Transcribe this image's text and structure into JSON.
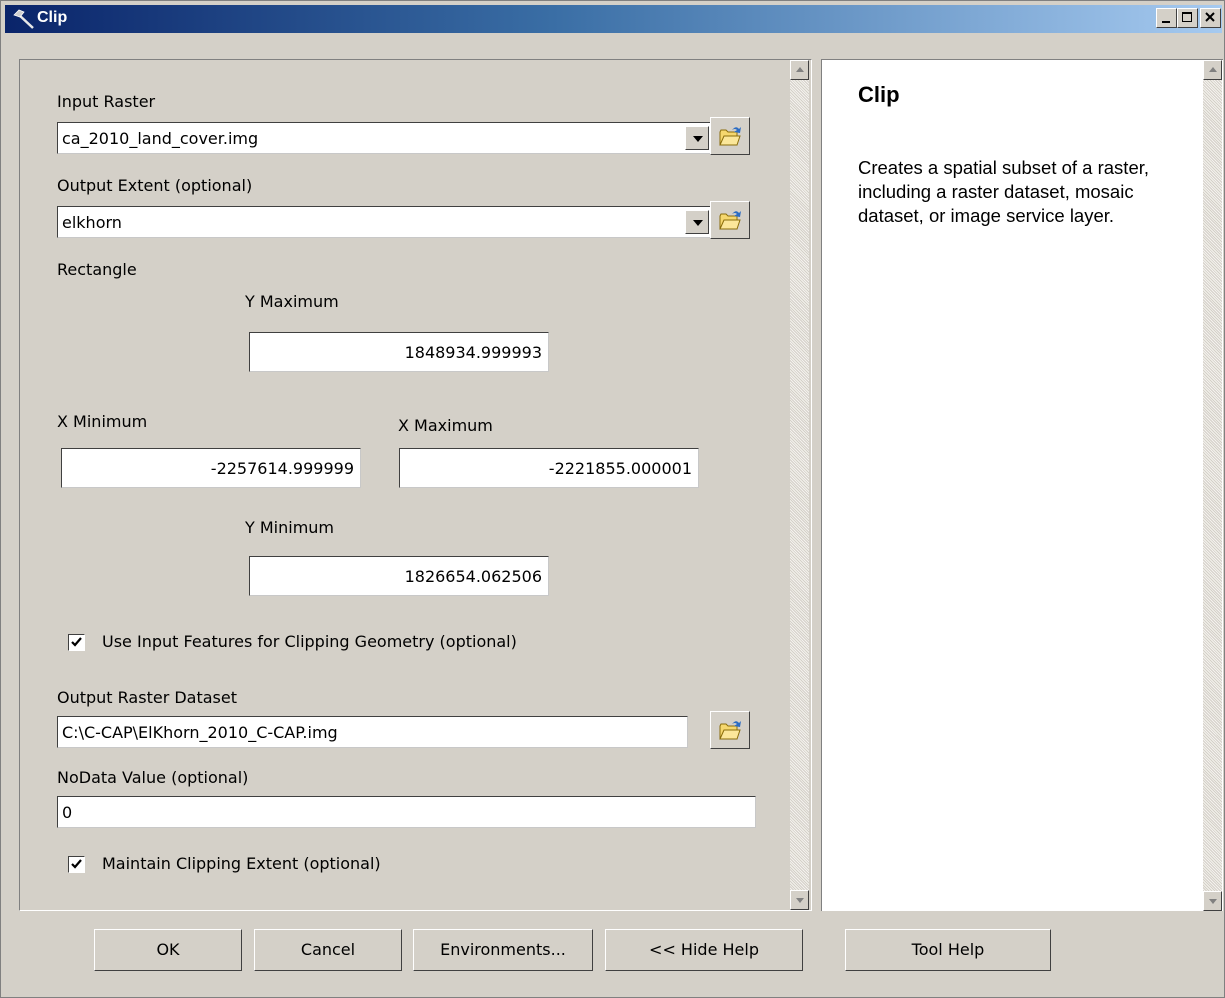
{
  "window": {
    "title": "Clip"
  },
  "form": {
    "input_raster_label": "Input Raster",
    "input_raster_value": "ca_2010_land_cover.img",
    "output_extent_label": "Output Extent (optional)",
    "output_extent_value": "elkhorn",
    "rectangle_label": "Rectangle",
    "y_max_label": "Y Maximum",
    "y_max_value": "1848934.999993",
    "x_min_label": "X Minimum",
    "x_min_value": "-2257614.999999",
    "x_max_label": "X Maximum",
    "x_max_value": "-2221855.000001",
    "y_min_label": "Y Minimum",
    "y_min_value": "1826654.062506",
    "use_input_features_label": "Use Input Features for Clipping Geometry (optional)",
    "use_input_features_checked": true,
    "output_raster_label": "Output Raster Dataset",
    "output_raster_value": "C:\\C-CAP\\ElKhorn_2010_C-CAP.img",
    "nodata_label": "NoData Value (optional)",
    "nodata_value": "0",
    "maintain_extent_label": "Maintain Clipping Extent (optional)",
    "maintain_extent_checked": true
  },
  "help": {
    "title": "Clip",
    "text": "Creates a spatial subset of a raster, including a raster dataset, mosaic dataset, or image service layer."
  },
  "buttons": {
    "ok": "OK",
    "cancel": "Cancel",
    "environments": "Environments...",
    "hide_help": "<< Hide Help",
    "tool_help": "Tool Help"
  },
  "icons": {
    "title": "hammer-icon",
    "browse": "open-folder-icon",
    "dropdown": "chevron-down-icon",
    "check": "checkmark-icon"
  },
  "colors": {
    "titlebar_start": "#0a246a",
    "titlebar_end": "#a6caf0",
    "dialog_bg": "#d4d0c8",
    "folder_yellow": "#f5d76e"
  }
}
